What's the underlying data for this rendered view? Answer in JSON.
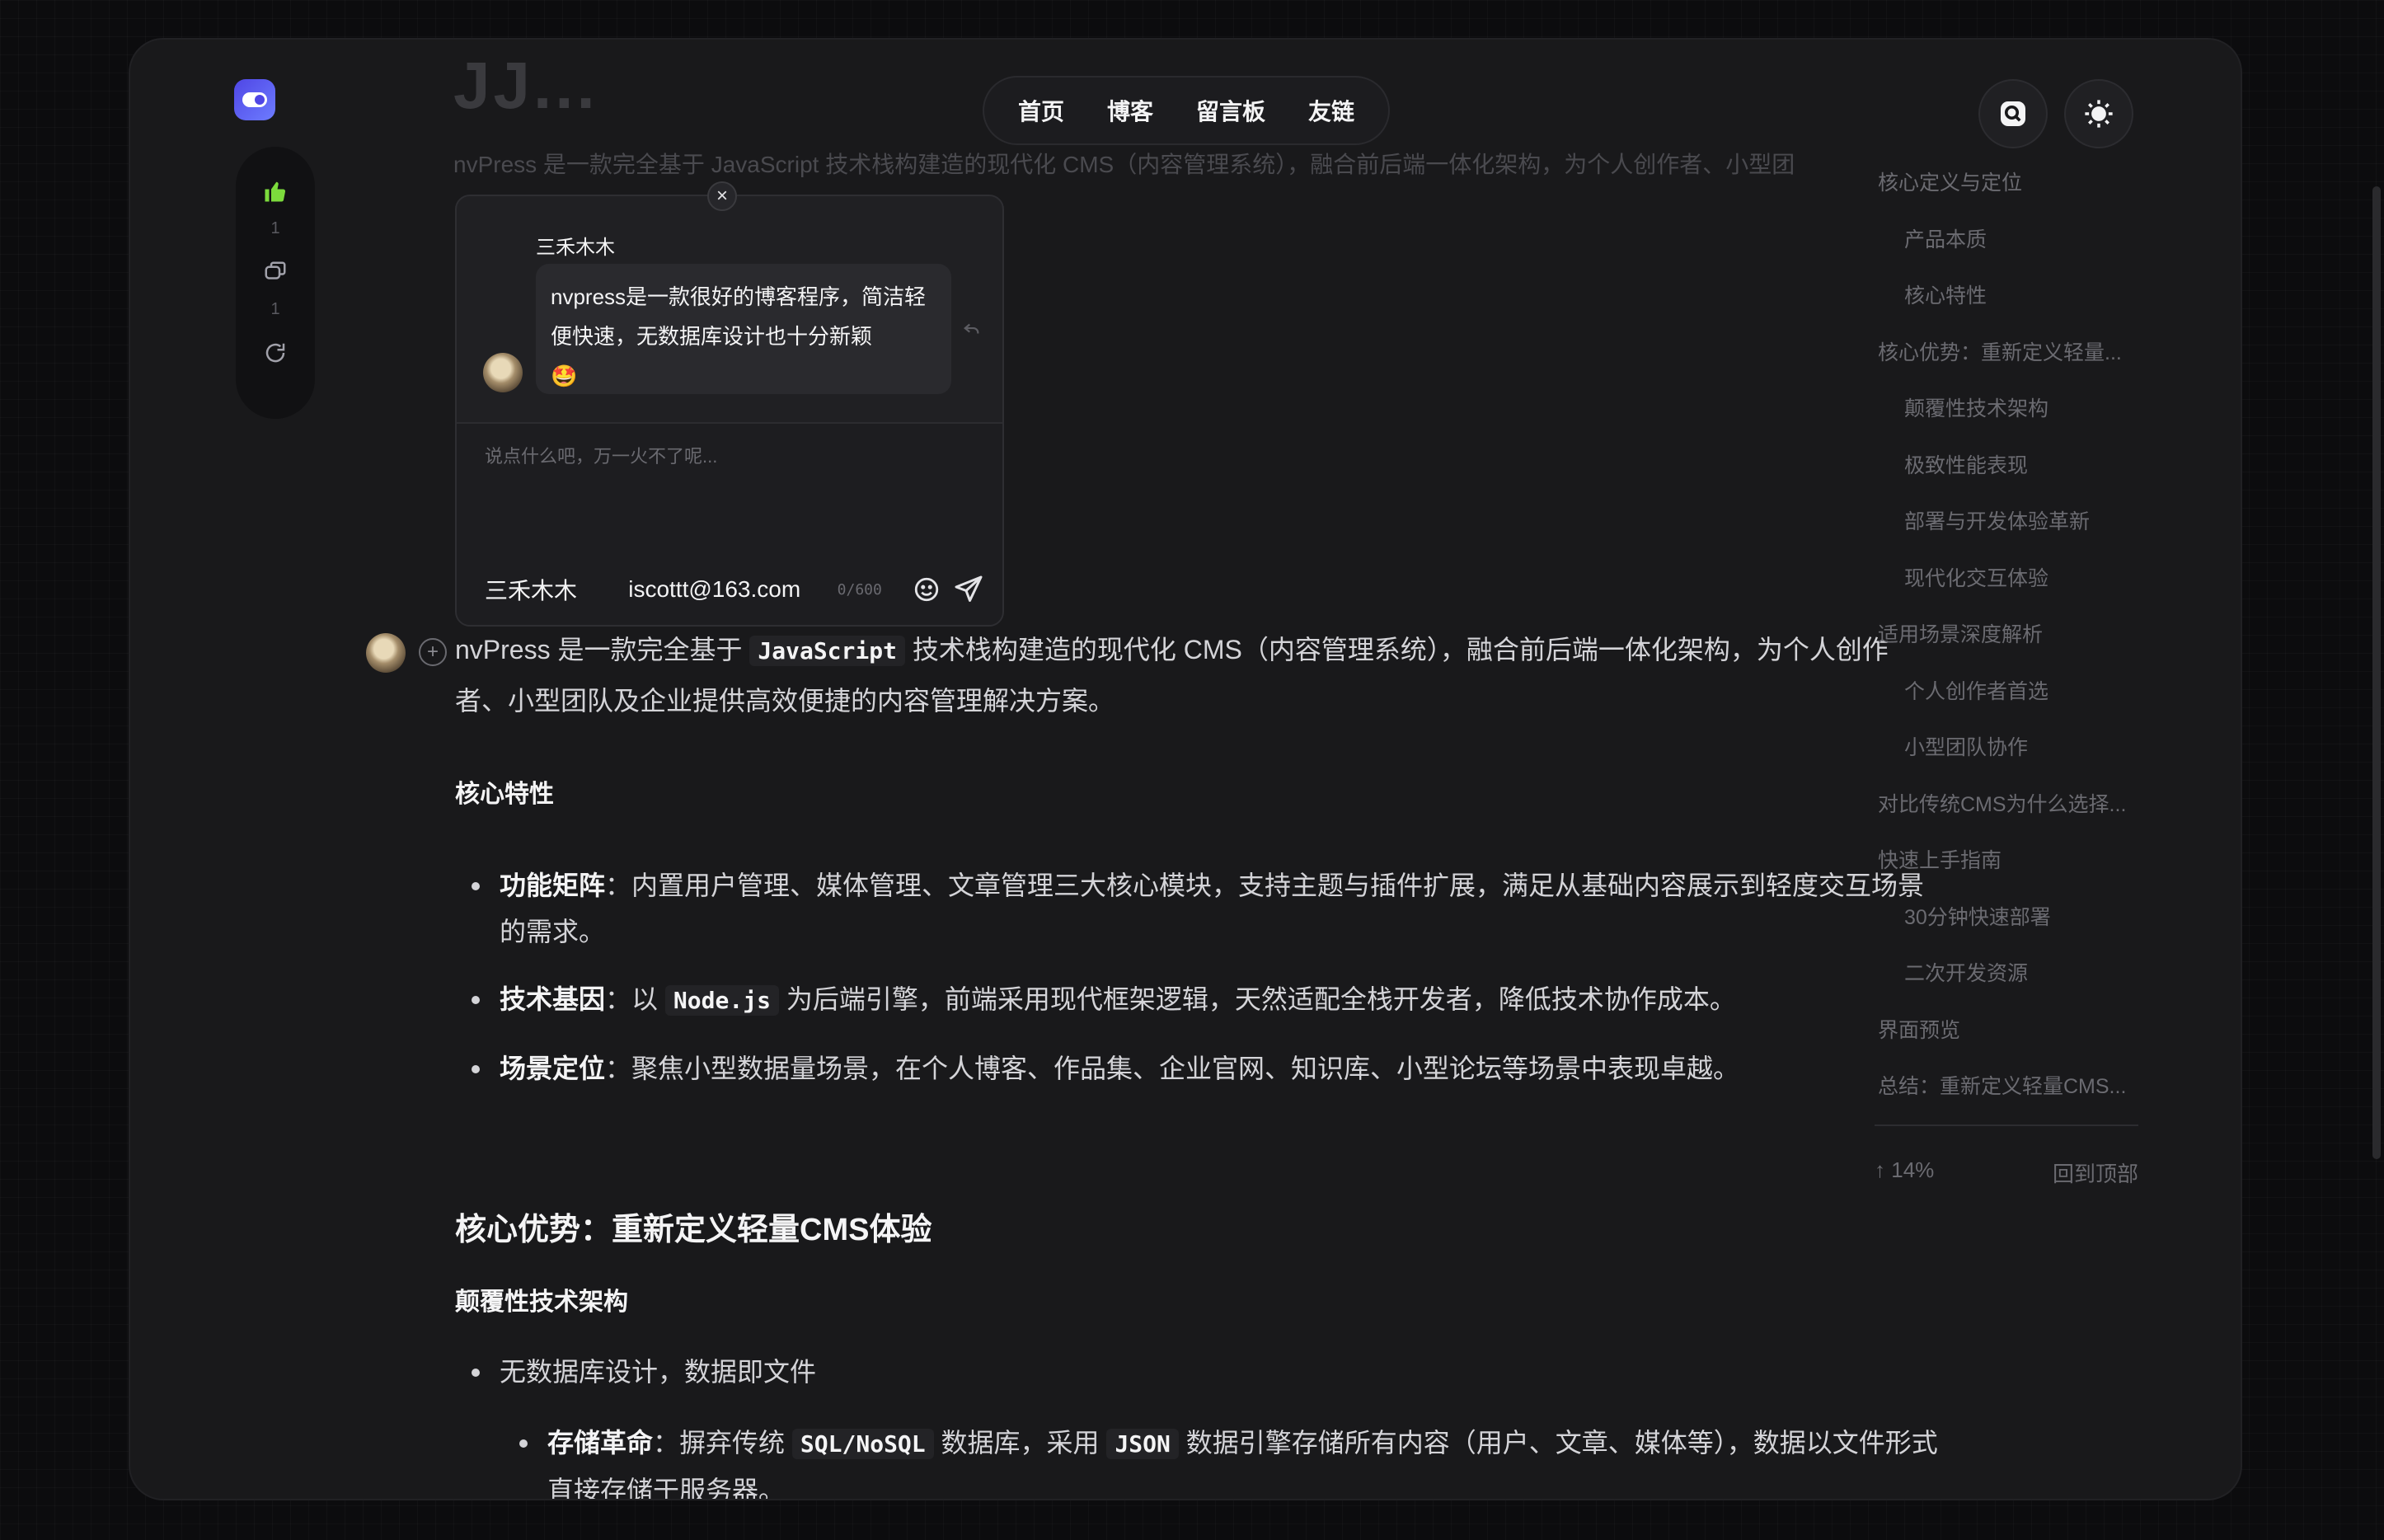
{
  "nav": {
    "items": [
      "首页",
      "博客",
      "留言板",
      "友链"
    ]
  },
  "header": {
    "title_fragment": "JJ...",
    "intro_faded": "nvPress 是一款完全基于 JavaScript 技术栈构建造的现代化 CMS（内容管理系统），融合前后端一体化架构，为个人创作者、小型团"
  },
  "rail": {
    "like_count": "1",
    "comment_count": "1"
  },
  "popup": {
    "close": "×",
    "author": "三禾木木",
    "comment": "nvpress是一款很好的博客程序，简洁轻便快速，无数据库设计也十分新颖",
    "emoji": "🤩",
    "placeholder": "说点什么吧，万一火不了呢...",
    "name": "三禾木木",
    "email": "iscottt@163.com",
    "count": "0/600"
  },
  "article": {
    "intro_a": "nvPress 是一款完全基于 ",
    "intro_code": "JavaScript",
    "intro_b": " 技术栈构建造的现代化 CMS（内容管理系统），融合前后端一体化架构，为个人创作者、小型团队及企业提供高效便捷的内容管理解决方案。",
    "h_features": "核心特性",
    "features": [
      {
        "label": "功能矩阵",
        "text": "：内置用户管理、媒体管理、文章管理三大核心模块，支持主题与插件扩展，满足从基础内容展示到轻度交互场景的需求。"
      },
      {
        "label": "技术基因",
        "text_a": "：以 ",
        "code": "Node.js",
        "text_b": " 为后端引擎，前端采用现代框架逻辑，天然适配全栈开发者，降低技术协作成本。"
      },
      {
        "label": "场景定位",
        "text": "：聚焦小型数据量场景，在个人博客、作品集、企业官网、知识库、小型论坛等场景中表现卓越。"
      }
    ],
    "h_advantages": "核心优势：重新定义轻量CMS体验",
    "h_arch": "颠覆性技术架构",
    "arch_item": "无数据库设计，数据即文件",
    "storage": {
      "label": "存储革命",
      "text_a": "：摒弃传统 ",
      "code1": "SQL/NoSQL",
      "text_b": " 数据库，采用 ",
      "code2": "JSON",
      "text_c": " 数据引擎存储所有内容（用户、文章、媒体等），数据以文件形式直接存储于服务器。"
    }
  },
  "toc": {
    "items": [
      {
        "label": "核心定义与定位",
        "level": 1
      },
      {
        "label": "产品本质",
        "level": 2
      },
      {
        "label": "核心特性",
        "level": 2
      },
      {
        "label": "核心优势：重新定义轻量...",
        "level": 1
      },
      {
        "label": "颠覆性技术架构",
        "level": 2
      },
      {
        "label": "极致性能表现",
        "level": 2
      },
      {
        "label": "部署与开发体验革新",
        "level": 2
      },
      {
        "label": "现代化交互体验",
        "level": 2
      },
      {
        "label": "适用场景深度解析",
        "level": 1
      },
      {
        "label": "个人创作者首选",
        "level": 2
      },
      {
        "label": "小型团队协作",
        "level": 2
      },
      {
        "label": "对比传统CMS为什么选择...",
        "level": 1
      },
      {
        "label": "快速上手指南",
        "level": 1
      },
      {
        "label": "30分钟快速部署",
        "level": 2
      },
      {
        "label": "二次开发资源",
        "level": 2
      },
      {
        "label": "界面预览",
        "level": 1
      },
      {
        "label": "总结：重新定义轻量CMS...",
        "level": 1
      }
    ],
    "progress": "14%",
    "back_to_top": "回到顶部"
  },
  "colors": {
    "accent": "#4f46e5",
    "like": "#7cdb3c",
    "background": "#19191b"
  }
}
